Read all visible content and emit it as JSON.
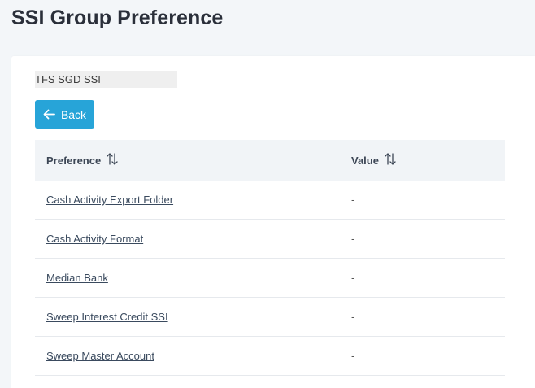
{
  "page": {
    "title": "SSI Group Preference"
  },
  "group": {
    "name": "TFS SGD SSI"
  },
  "back_button": {
    "label": "Back",
    "icon": "arrow-left-icon",
    "color": "#27a4d8"
  },
  "table": {
    "columns": [
      {
        "label": "Preference",
        "sort_icon": "sort-icon"
      },
      {
        "label": "Value",
        "sort_icon": "sort-icon"
      }
    ],
    "rows": [
      {
        "preference": "Cash Activity Export Folder",
        "value": "-"
      },
      {
        "preference": "Cash Activity Format",
        "value": "-"
      },
      {
        "preference": "Median Bank",
        "value": "-"
      },
      {
        "preference": "Sweep Interest Credit SSI",
        "value": "-"
      },
      {
        "preference": "Sweep Master Account",
        "value": "-"
      }
    ]
  }
}
